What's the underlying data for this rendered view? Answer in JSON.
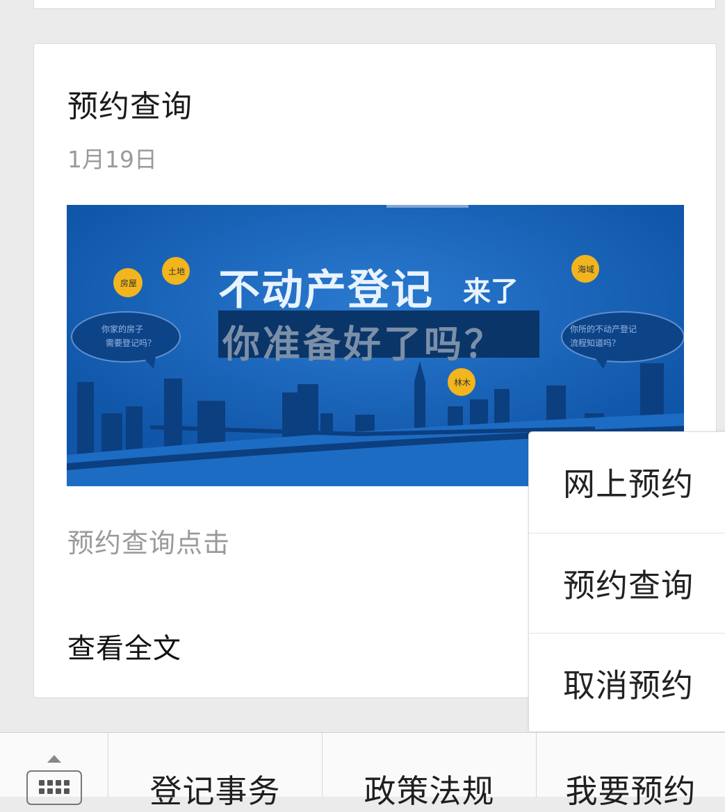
{
  "article": {
    "title": "预约查询",
    "date": "1月19日",
    "summary": "预约查询点击",
    "read_more": "查看全文",
    "cover": {
      "headline_line1": "不动产登记",
      "headline_line1_small": "来了",
      "headline_line2": "你准备好了吗？",
      "tags": [
        "房屋",
        "土地",
        "林木",
        "海域"
      ],
      "bubble_left": [
        "你家的房子",
        "需要登记吗？"
      ],
      "bubble_right": [
        "你所的不动产登记",
        "流程知道吗？"
      ]
    }
  },
  "popup_menu": {
    "items": [
      "网上预约",
      "预约查询",
      "取消预约"
    ]
  },
  "bottom_menu": {
    "items": [
      "登记事务",
      "政策法规",
      "我要预约"
    ]
  },
  "colors": {
    "background": "#ebebeb",
    "cover_blue": "#1462b8",
    "tag_yellow": "#f2b51d"
  }
}
